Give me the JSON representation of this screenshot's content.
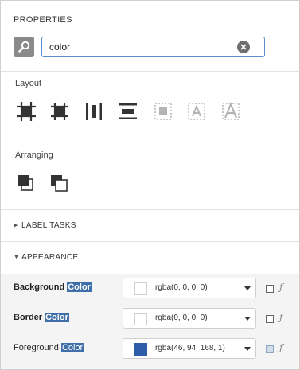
{
  "panel": {
    "title": "PROPERTIES"
  },
  "search": {
    "value": "color"
  },
  "layout": {
    "label": "Layout",
    "tools": [
      "align-to-grid-icon",
      "size-to-grid-icon",
      "center-horizontally-icon",
      "center-vertically-icon",
      "fit-bounds-icon",
      "fit-text-icon",
      "grow-text-icon"
    ]
  },
  "arranging": {
    "label": "Arranging",
    "tools": [
      "bring-to-front-icon",
      "send-to-back-icon"
    ]
  },
  "sections": {
    "label_tasks": "LABEL TASKS",
    "appearance": "APPEARANCE"
  },
  "properties": [
    {
      "prefix": "Background ",
      "match": "Color",
      "value": "rgba(0, 0, 0, 0)",
      "swatch": "#ffffff",
      "bold": true
    },
    {
      "prefix": "Border ",
      "match": "Color",
      "value": "rgba(0, 0, 0, 0)",
      "swatch": "#ffffff",
      "bold": true
    },
    {
      "prefix": "Foreground ",
      "match": "Color",
      "value": "rgba(46, 94, 168, 1)",
      "swatch": "#2e5ea8",
      "bold": false
    }
  ],
  "colors": {
    "accent": "#5b8fd1",
    "highlight": "#3f6fa8"
  }
}
